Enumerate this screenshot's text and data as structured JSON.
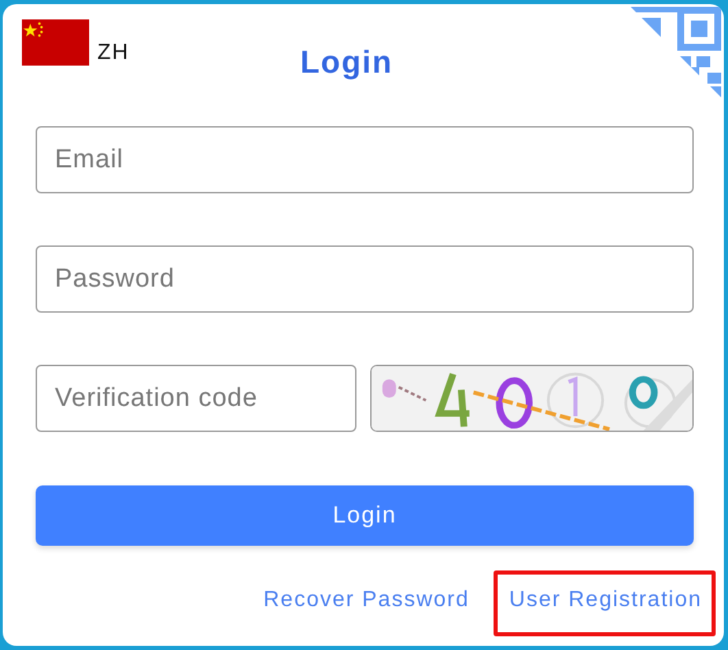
{
  "language": {
    "code": "ZH"
  },
  "title": "Login",
  "fields": [
    {
      "placeholder": "Email"
    },
    {
      "placeholder": "Password"
    },
    {
      "placeholder": "Verification code"
    }
  ],
  "login_button": "Login",
  "links": [
    {
      "label": "Recover Password",
      "highlighted": false
    },
    {
      "label": "User Registration",
      "highlighted": true
    }
  ]
}
